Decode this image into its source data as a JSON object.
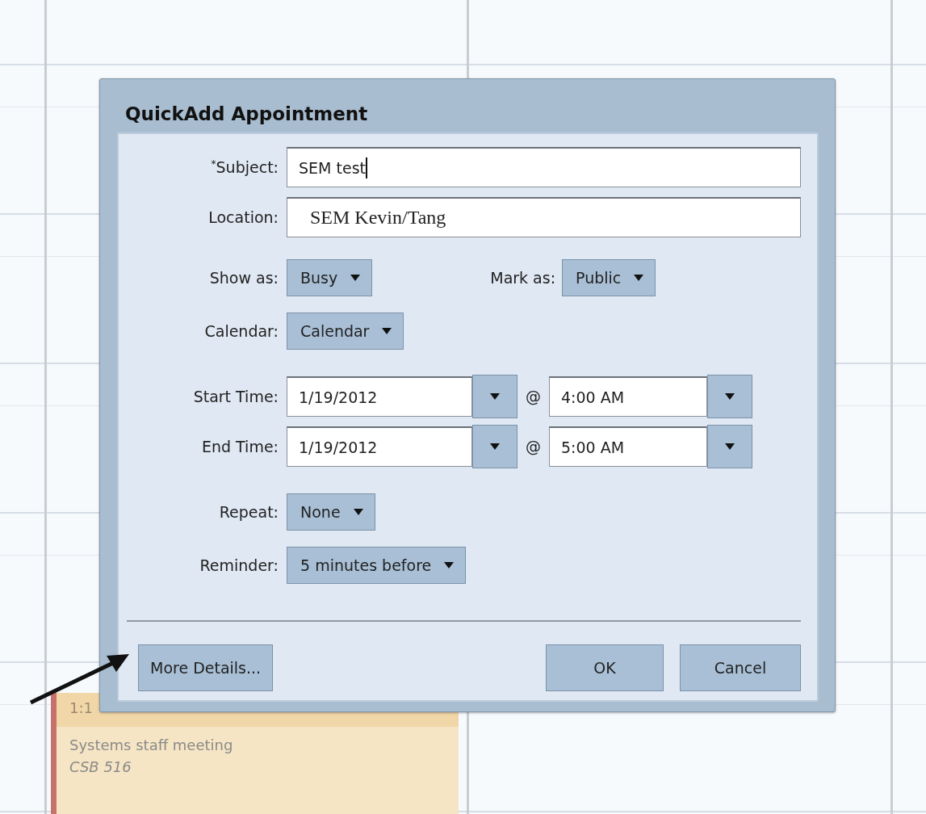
{
  "calendar": {
    "event": {
      "time": "1:1",
      "title": "Systems staff meeting",
      "location": "CSB 516"
    }
  },
  "dialog": {
    "title": "QuickAdd Appointment",
    "rows": [
      {
        "kind": "text",
        "marker": "*",
        "label": "Subject:",
        "value": "SEM test",
        "focused": true
      },
      {
        "kind": "overlay_text",
        "label": "Location:",
        "value": "SEM Kevin/Tang"
      },
      {
        "kind": "dropdown_pair",
        "label": "Show as:",
        "value": "Busy",
        "label2": "Mark as:",
        "value2": "Public"
      },
      {
        "kind": "dropdown",
        "label": "Calendar:",
        "value": "Calendar"
      },
      {
        "kind": "datetime",
        "label": "Start Time:",
        "date": "1/19/2012",
        "at": "@",
        "time": "4:00 AM"
      },
      {
        "kind": "datetime",
        "label": "End Time:",
        "date": "1/19/2012",
        "at": "@",
        "time": "5:00 AM"
      },
      {
        "kind": "dropdown",
        "label": "Repeat:",
        "value": "None"
      },
      {
        "kind": "dropdown",
        "label": "Reminder:",
        "value": "5 minutes before"
      }
    ],
    "left_buttons": [
      "More Details..."
    ],
    "right_buttons": [
      "OK",
      "Cancel"
    ]
  }
}
